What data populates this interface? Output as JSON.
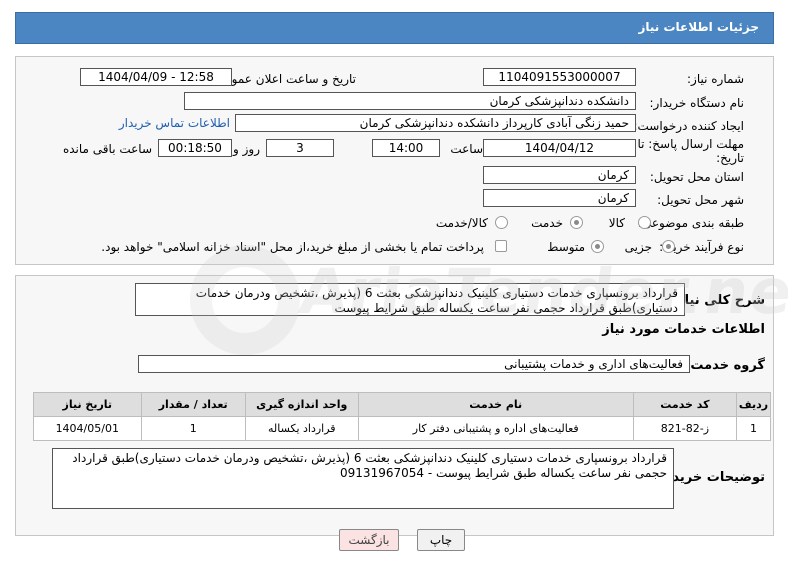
{
  "header": {
    "title": "جزئیات اطلاعات نیاز"
  },
  "form": {
    "need_number_label": "شماره نیاز:",
    "need_number": "1104091553000007",
    "announce_label": "تاریخ و ساعت اعلان عمومی:",
    "announce_value": "1404/04/09 - 12:58",
    "buyer_org_label": "نام دستگاه خریدار:",
    "buyer_org": "دانشکده دندانپزشکی کرمان",
    "requester_label": "ایجاد کننده درخواست:",
    "requester": "حمید زنگی آبادی کارپرداز دانشکده دندانپزشکی کرمان",
    "contact_link": "اطلاعات تماس خریدار",
    "deadline_label_1": "مهلت ارسال پاسخ: تا",
    "deadline_label_2": "تاریخ:",
    "deadline_date": "1404/04/12",
    "time_label": "ساعت",
    "deadline_time": "14:00",
    "days_value": "3",
    "days_label": "روز و",
    "remaining_time": "00:18:50",
    "remaining_label": "ساعت باقی مانده",
    "province_label": "استان محل تحویل:",
    "province": "کرمان",
    "city_label": "شهر محل تحویل:",
    "city": "کرمان",
    "category_label": "طبقه بندی موضوعی:",
    "category_options": [
      "کالا",
      "خدمت",
      "کالا/خدمت"
    ],
    "category_selected": "خدمت",
    "process_label": "نوع فرآیند خرید :",
    "process_options": [
      "جزیی",
      "متوسط"
    ],
    "process_selected": "جزیی",
    "payment_note": "پرداخت تمام یا بخشی از مبلغ خرید،از محل \"اسناد خزانه اسلامی\" خواهد بود."
  },
  "summary": {
    "label": "شرح کلی نیاز:",
    "text": "قرارداد برونسپاری خدمات دستیاری کلینیک دندانپزشکی بعثت 6 (پذیرش ،تشخیص ودرمان خدمات دستیاری)طبق قرارداد حجمی نفر ساعت یکساله طبق شرایط پیوست"
  },
  "services": {
    "section_title": "اطلاعات خدمات مورد نیاز",
    "group_label": "گروه خدمت:",
    "group_value": "فعالیت‌های اداری و خدمات پشتیبانی",
    "columns": [
      "ردیف",
      "کد خدمت",
      "نام خدمت",
      "واحد اندازه گیری",
      "تعداد / مقدار",
      "تاریخ نیاز"
    ],
    "rows": [
      [
        "1",
        "ز-82-821",
        "فعالیت‌های اداره و پشتیبانی دفتر کار",
        "قرارداد یکساله",
        "1",
        "1404/05/01"
      ]
    ]
  },
  "buyer_notes": {
    "label": "توضیحات خریدار:",
    "text": "قرارداد برونسپاری خدمات دستیاری کلینیک دندانپزشکی بعثت 6 (پذیرش ،تشخیص ودرمان خدمات دستیاری)طبق قرارداد حجمی نفر ساعت یکساله طبق شرایط پیوست - 09131967054"
  },
  "buttons": {
    "print": "چاپ",
    "back": "بازگشت"
  },
  "colors": {
    "header": "#4c86c2",
    "link": "#1f5fb0",
    "back_button": "#fbe3e3"
  },
  "watermark": {
    "text": "AriaTender.neT"
  }
}
